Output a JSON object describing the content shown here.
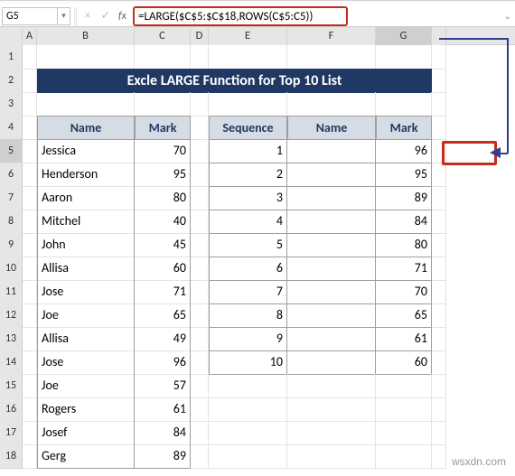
{
  "namebox": {
    "value": "G5"
  },
  "formula_bar": {
    "fx_label": "fx",
    "formula": "=LARGE($C$5:$C$18,ROWS(C$5:C5))"
  },
  "columns": [
    "A",
    "B",
    "C",
    "D",
    "E",
    "F",
    "G"
  ],
  "banner": "Excle LARGE Function for Top 10 List",
  "table_left": {
    "headers": {
      "name": "Name",
      "mark": "Mark"
    },
    "rows": [
      {
        "name": "Jessica",
        "mark": 70
      },
      {
        "name": "Henderson",
        "mark": 95
      },
      {
        "name": "Aaron",
        "mark": 80
      },
      {
        "name": "Mitchel",
        "mark": 40
      },
      {
        "name": "John",
        "mark": 45
      },
      {
        "name": "Allisa",
        "mark": 60
      },
      {
        "name": "Jose",
        "mark": 71
      },
      {
        "name": "Joe",
        "mark": 65
      },
      {
        "name": "Allisa",
        "mark": 49
      },
      {
        "name": "Jose",
        "mark": 96
      },
      {
        "name": "Joe",
        "mark": 57
      },
      {
        "name": "Rogers",
        "mark": 61
      },
      {
        "name": "Josef",
        "mark": 84
      },
      {
        "name": "Gerg",
        "mark": 89
      }
    ]
  },
  "table_right": {
    "headers": {
      "seq": "Sequence",
      "name": "Name",
      "mark": "Mark"
    },
    "rows": [
      {
        "seq": 1,
        "name": "",
        "mark": 96
      },
      {
        "seq": 2,
        "name": "",
        "mark": 95
      },
      {
        "seq": 3,
        "name": "",
        "mark": 89
      },
      {
        "seq": 4,
        "name": "",
        "mark": 84
      },
      {
        "seq": 5,
        "name": "",
        "mark": 80
      },
      {
        "seq": 6,
        "name": "",
        "mark": 71
      },
      {
        "seq": 7,
        "name": "",
        "mark": 70
      },
      {
        "seq": 8,
        "name": "",
        "mark": 65
      },
      {
        "seq": 9,
        "name": "",
        "mark": 61
      },
      {
        "seq": 10,
        "name": "",
        "mark": 60
      }
    ]
  },
  "selected_cell_ref": "G5",
  "watermark": "wsxdn.com"
}
